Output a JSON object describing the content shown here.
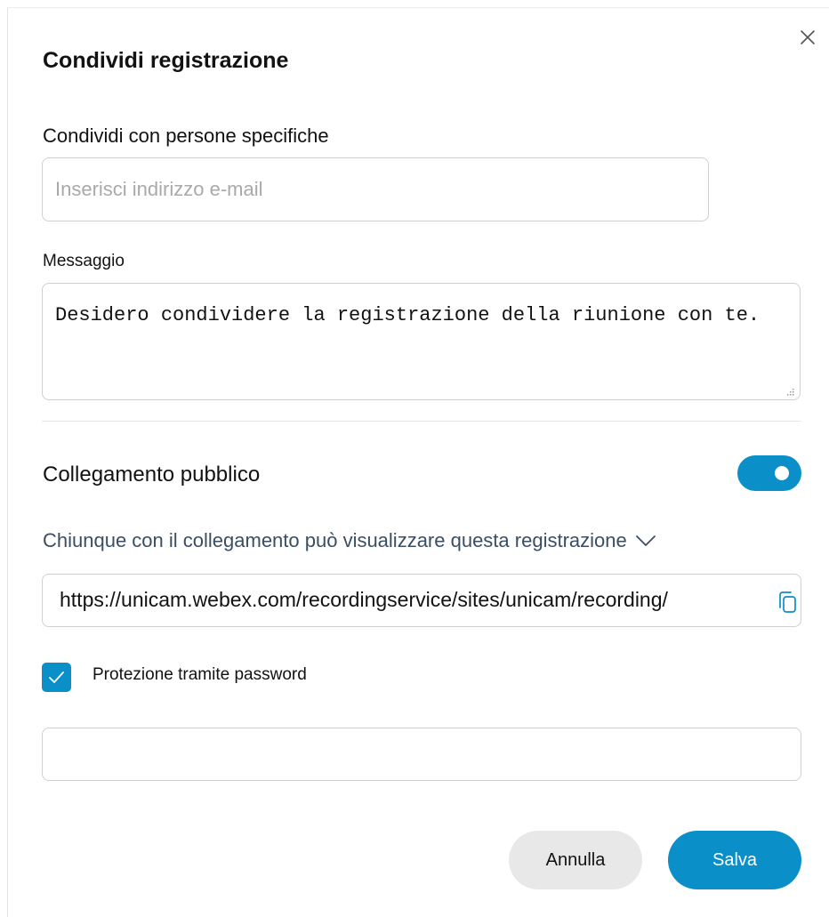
{
  "dialog": {
    "title": "Condividi registrazione",
    "close_icon": "close-icon"
  },
  "share_people": {
    "label": "Condividi con persone specifiche",
    "email_placeholder": "Inserisci indirizzo e-mail",
    "email_value": ""
  },
  "message": {
    "label": "Messaggio",
    "text": "Desidero condividere la registrazione della riunione con te."
  },
  "public_link": {
    "label": "Collegamento pubblico",
    "enabled": true,
    "access_text": "Chiunque con il collegamento può visualizzare questa registrazione",
    "access_icon": "chevron-down-icon",
    "url": "https://unicam.webex.com/recordingservice/sites/unicam/recording/",
    "copy_icon": "copy-icon"
  },
  "password": {
    "label": "Protezione tramite password",
    "checked": true,
    "value": ""
  },
  "footer": {
    "cancel_label": "Annulla",
    "save_label": "Salva"
  },
  "colors": {
    "accent": "#0a8fc9",
    "secondary_button": "#e8e8e8",
    "access_text": "#3b4e63"
  }
}
